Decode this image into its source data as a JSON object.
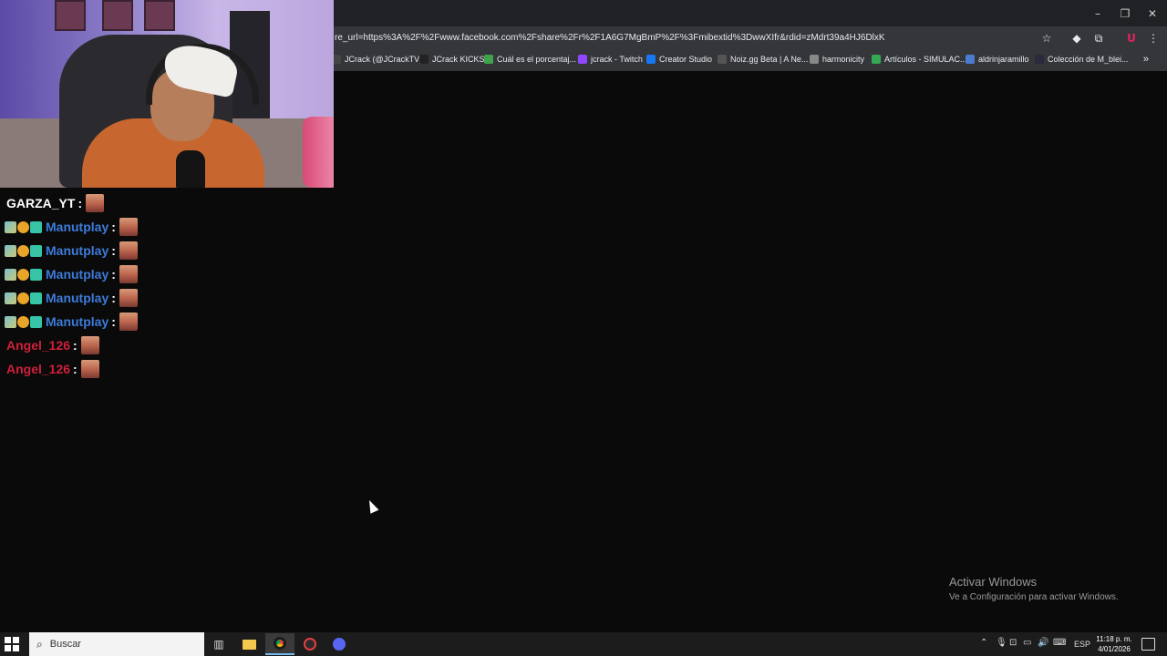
{
  "browser": {
    "url": "re_url=https%3A%2F%2Fwww.facebook.com%2Fshare%2Fr%2F1A6G7MgBmP%2F%3Fmibextid%3DwwXIfr&rdid=zMdrt39a4HJ6DlxK",
    "window_controls": {
      "minimize": "–",
      "restore": "❐",
      "close": "✕"
    },
    "toolbar_icons": [
      "star-icon",
      "diamond-icon",
      "extensions-icon",
      "profile-icon",
      "menu-icon"
    ],
    "bookmarks": [
      {
        "label": "JCrack (@JCrackTV)...",
        "icon_color": "#444"
      },
      {
        "label": "JCrack KICKS",
        "icon_color": "#222"
      },
      {
        "label": "Cuál es el porcentaj...",
        "icon_color": "#3fa34d"
      },
      {
        "label": "jcrack - Twitch",
        "icon_color": "#9146ff"
      },
      {
        "label": "Creator Studio",
        "icon_color": "#1877f2"
      },
      {
        "label": "Noiz.gg Beta | A Ne...",
        "icon_color": "#555"
      },
      {
        "label": "harmonicity",
        "icon_color": "#888"
      },
      {
        "label": "Artículos - SIMULAC...",
        "icon_color": "#34a853"
      },
      {
        "label": "aldrinjaramillo",
        "icon_color": "#4a7bd0"
      },
      {
        "label": "Colección de M_blei...",
        "icon_color": "#2a2a3a"
      }
    ],
    "bookmarks_more": "»"
  },
  "chat": {
    "messages": [
      {
        "user": "GARZA_YT",
        "color": "#ffffff",
        "badges": false
      },
      {
        "user": "Manutplay",
        "color": "#3d7bd9",
        "badges": true
      },
      {
        "user": "Manutplay",
        "color": "#3d7bd9",
        "badges": true
      },
      {
        "user": "Manutplay",
        "color": "#3d7bd9",
        "badges": true
      },
      {
        "user": "Manutplay",
        "color": "#3d7bd9",
        "badges": true
      },
      {
        "user": "Manutplay",
        "color": "#3d7bd9",
        "badges": true
      },
      {
        "user": "Angel_126",
        "color": "#d0203a",
        "badges": false
      },
      {
        "user": "Angel_126",
        "color": "#d0203a",
        "badges": false
      }
    ],
    "separator": ":"
  },
  "watermark": {
    "title": "Activar Windows",
    "subtitle": "Ve a Configuración para activar Windows."
  },
  "taskbar": {
    "search_placeholder": "Buscar",
    "language": "ESP",
    "time": "11:18 p. m.",
    "date": "4/01/2026"
  }
}
